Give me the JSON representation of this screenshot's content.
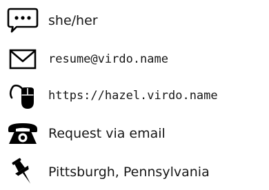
{
  "contacts": {
    "pronouns": {
      "icon": "speech-bubble-icon",
      "text": "she/her"
    },
    "email": {
      "icon": "envelope-icon",
      "text": "resume@virdo.name"
    },
    "website": {
      "icon": "computer-mouse-icon",
      "text": "https://hazel.virdo.name"
    },
    "phone": {
      "icon": "telephone-icon",
      "text": "Request via email"
    },
    "location": {
      "icon": "pushpin-icon",
      "text": "Pittsburgh, Pennsylvania"
    }
  },
  "colors": {
    "icon": "#000000",
    "text": "#161616",
    "background": "#ffffff"
  }
}
